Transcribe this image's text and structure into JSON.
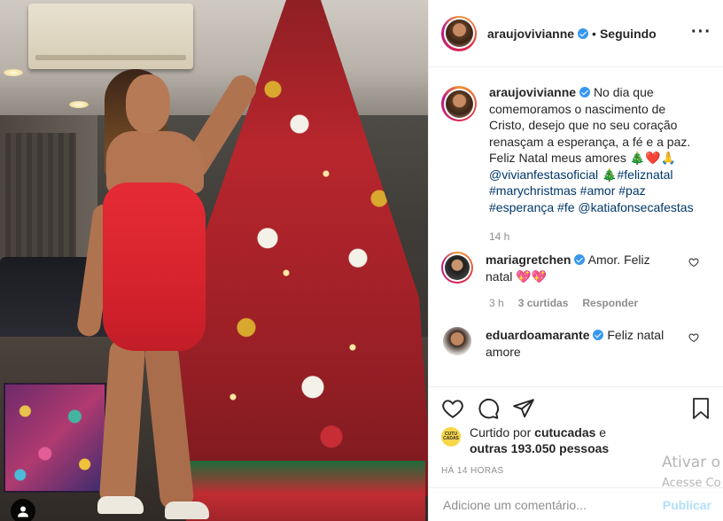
{
  "post": {
    "username": "araujovivianne",
    "follow_state": "Seguindo",
    "separator": "•",
    "more_icon": "more-icon",
    "caption": {
      "text": "No dia que comemoramos o nascimento de Cristo, desejo que no seu coração renasçam a esperança, a fé e a paz. Feliz Natal meus amores",
      "emoji": "🎄❤️🙏",
      "mention_1": "@vivianfestasoficial",
      "emoji_2": "🎄",
      "hashtags": "#feliznatal #marychristmas #amor #paz #esperança #fe",
      "mention_2": "@katiafonsecafestas",
      "time": "14 h"
    },
    "comments": [
      {
        "username": "mariagretchen",
        "text": "Amor. Feliz natal",
        "emoji": "💖💖",
        "time": "3 h",
        "likes": "3 curtidas",
        "reply": "Responder"
      },
      {
        "username": "eduardoamarante",
        "text": "Feliz natal amore"
      }
    ],
    "liked_by": {
      "avatar_label": "CUTU CADAS",
      "prefix": "Curtido por",
      "user": "cutucadas",
      "conjunction": "e",
      "others": "outras 193.050 pessoas"
    },
    "posted_ago": "HÁ 14 HORAS",
    "add_comment_placeholder": "Adicione um comentário...",
    "publish_label": "Publicar"
  },
  "watermark": {
    "title": "Ativar o",
    "subtitle": "Acesse Co"
  },
  "colors": {
    "link": "#00376b",
    "verified": "#3897f0",
    "publish_disabled": "#b2dffc",
    "dress_red": "#e52b35"
  },
  "icons": [
    "heart-icon",
    "comment-icon",
    "share-icon",
    "bookmark-icon",
    "user-tag-icon",
    "verified-icon"
  ]
}
